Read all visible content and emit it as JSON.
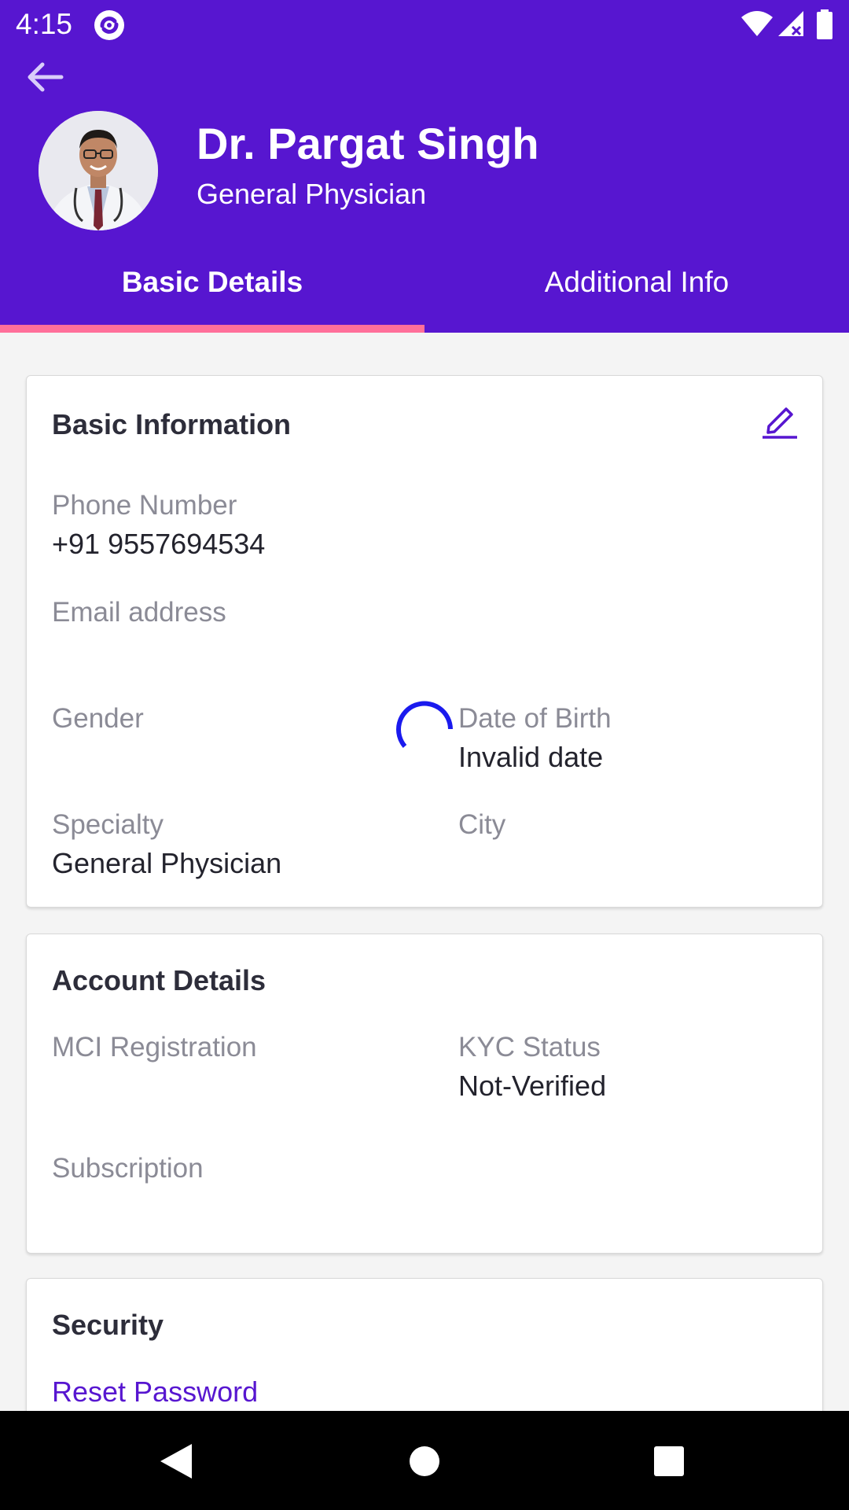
{
  "status_bar": {
    "time": "4:15",
    "icons": [
      "app-notification-icon",
      "wifi-icon",
      "signal-icon",
      "battery-icon"
    ]
  },
  "header": {
    "back_icon": "arrow-left-icon",
    "doctor_name": "Dr. Pargat Singh",
    "doctor_title": "General Physician",
    "background_color": "#5716d0"
  },
  "tabs": [
    {
      "label": "Basic Details",
      "selected": true
    },
    {
      "label": "Additional Info",
      "selected": false
    }
  ],
  "tab_indicator_color": "#ff6f9a",
  "basic_information": {
    "title": "Basic Information",
    "edit_icon": "pencil-icon",
    "phone_label": "Phone Number",
    "phone_value": "+91 9557694534",
    "email_label": "Email address",
    "email_value": "",
    "gender_label": "Gender",
    "gender_value": "",
    "dob_label": "Date of Birth",
    "dob_value": "Invalid date",
    "specialty_label": "Specialty",
    "specialty_value": "General Physician",
    "city_label": "City",
    "city_value": ""
  },
  "account_details": {
    "title": "Account Details",
    "mci_label": "MCI Registration",
    "mci_value": "",
    "kyc_label": "KYC Status",
    "kyc_value": "Not-Verified",
    "subscription_label": "Subscription",
    "subscription_value": ""
  },
  "security": {
    "title": "Security",
    "reset_password_label": "Reset Password"
  },
  "loading_spinner_color": "#1a1aee",
  "navigation_bar": {
    "icons": [
      "nav-back-icon",
      "nav-home-icon",
      "nav-recents-icon"
    ]
  }
}
